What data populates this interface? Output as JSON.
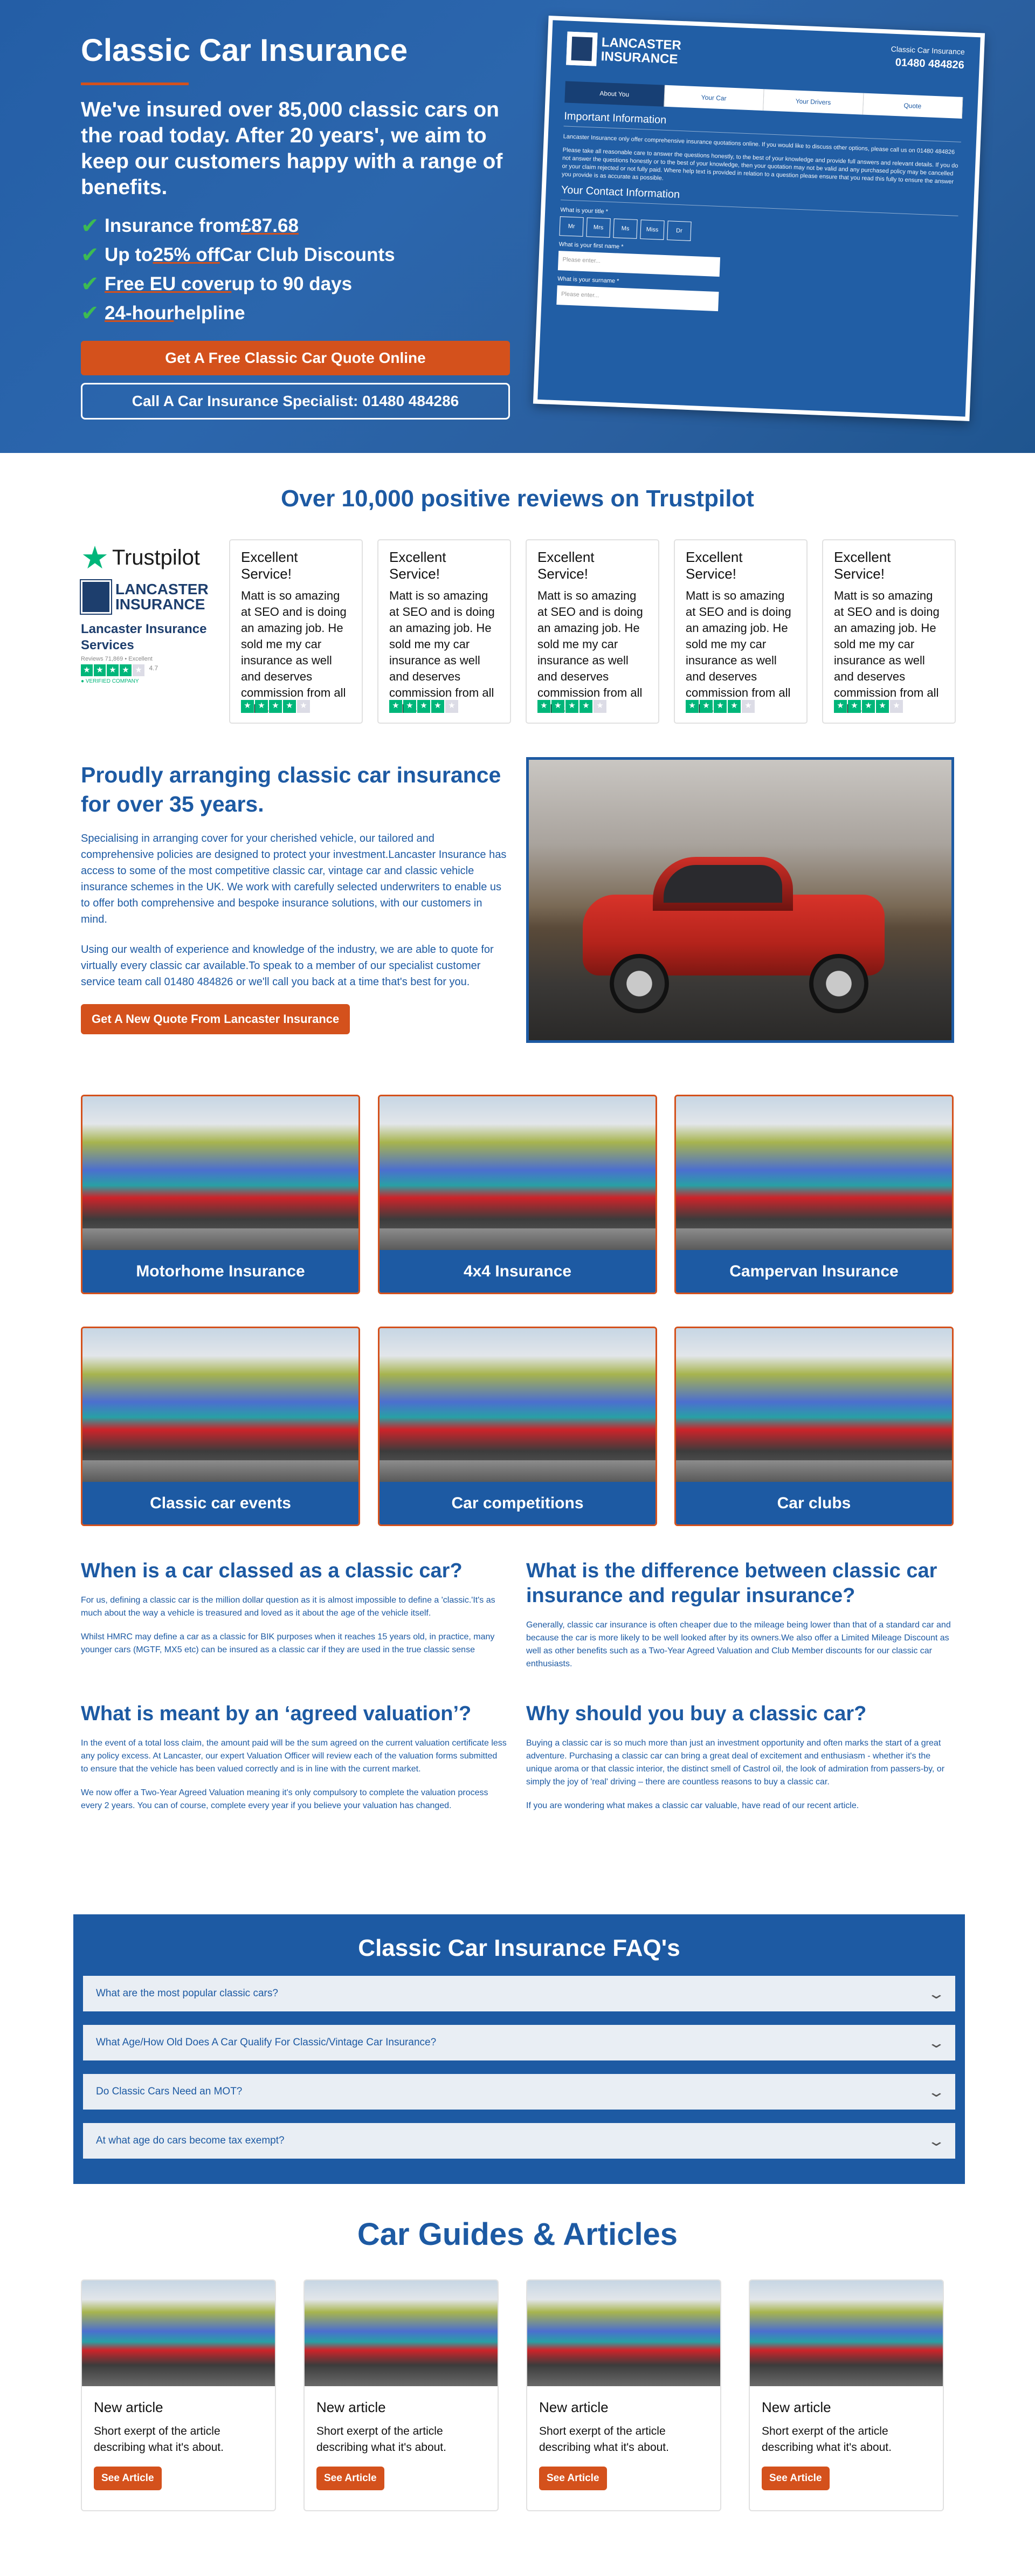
{
  "hero": {
    "title": "Classic Car Insurance",
    "intro": "We've insured over 85,000 classic cars on the road today. After 20 years', we aim to keep our customers happy with a range of benefits.",
    "benefits": [
      {
        "pre": "Insurance from ",
        "highlight": "£87.68",
        "post": ""
      },
      {
        "pre": "Up to ",
        "highlight": "25% off",
        "post": " Car Club Discounts"
      },
      {
        "pre": "",
        "highlight": "Free EU cover",
        "post": " up to 90 days"
      },
      {
        "pre": "",
        "highlight": "24-hour",
        "post": " helpline"
      }
    ],
    "cta_quote": "Get A Free Classic Car Quote Online",
    "cta_call": "Call A Car Insurance Specialist: 01480 484286"
  },
  "form": {
    "logo_line1": "LANCASTER",
    "logo_line2": "INSURANCE",
    "contact_label": "Classic Car Insurance",
    "phone": "01480 484826",
    "steps": [
      "About You",
      "Your Car",
      "Your Drivers",
      "Quote"
    ],
    "important_title": "Important Information",
    "important_text1": "Lancaster Insurance only offer comprehensive insurance quotations online. If you would like to discuss other options, please call us on 01480 484826",
    "important_text2": "Please take all reasonable care to answer the questions honestly, to the best of your knowledge and provide full answers and relevant details. If you do not answer the questions honestly or to the best of your knowledge, then your quotation may not be valid and any purchased policy may be cancelled or your claim rejected or not fully paid. Where help text is provided in relation to a question please ensure that you read this fully to ensure the answer you provide is as accurate as possible.",
    "contact_title": "Your Contact Information",
    "title_label": "What is your title *",
    "title_options": [
      "Mr",
      "Mrs",
      "Ms",
      "Miss",
      "Dr"
    ],
    "first_label": "What is your first name *",
    "first_placeholder": "Please enter...",
    "surname_label": "What is your surname *",
    "surname_placeholder": "Please enter..."
  },
  "reviews": {
    "title": "Over 10,000 positive reviews on Trustpilot",
    "trustpilot": "Trustpilot",
    "logo_line1": "LANCASTER",
    "logo_line2": "INSURANCE",
    "company": "Lancaster Insurance Services",
    "sub": "Reviews 71,869 • Excellent",
    "score": "4.7",
    "verified": "● VERIFIED COMPANY",
    "items": [
      {
        "title": "Excellent Service!",
        "text": "Matt is so amazing at SEO and is doing an amazing job. He sold me my car insurance as well and deserves commission from all sales",
        "rating": 4
      },
      {
        "title": "Excellent Service!",
        "text": "Matt is so amazing at SEO and is doing an amazing job. He sold me my car insurance as well and deserves commission from all sales",
        "rating": 4
      },
      {
        "title": "Excellent Service!",
        "text": "Matt is so amazing at SEO and is doing an amazing job. He sold me my car insurance as well and deserves commission from all sales",
        "rating": 4
      },
      {
        "title": "Excellent Service!",
        "text": "Matt is so amazing at SEO and is doing an amazing job. He sold me my car insurance as well and deserves commission from all sales",
        "rating": 4
      },
      {
        "title": "Excellent Service!",
        "text": "Matt is so amazing at SEO and is doing an amazing job. He sold me my car insurance as well and deserves commission from all sales",
        "rating": 4
      }
    ]
  },
  "about": {
    "title": "Proudly arranging classic car insurance for over 35 years.",
    "p1": "Specialising in arranging cover for your cherished vehicle, our tailored and comprehensive policies are designed to protect your investment.Lancaster Insurance has access to some of the most competitive classic car, vintage car and classic vehicle insurance schemes in the UK. We work with carefully selected underwriters to enable us to offer both comprehensive and bespoke insurance solutions, with our customers in mind.",
    "p2": "Using our wealth of experience and knowledge of the industry, we are able to quote for virtually every classic car available.To speak to a member of our specialist customer service team call 01480 484826 or we'll call you back at a time that's best for you.",
    "cta": "Get A New Quote From Lancaster Insurance"
  },
  "tiles": [
    "Motorhome Insurance",
    "4x4 Insurance",
    "Campervan Insurance",
    "Classic car events",
    "Car competitions",
    "Car clubs"
  ],
  "info": {
    "q1": {
      "title": "When is a car classed as a classic car?",
      "p1": "For us, defining a classic car is the million dollar question as it is almost impossible to define a 'classic.'It's as much about the way a vehicle is treasured and loved as it about the age of the vehicle itself.",
      "p2": "Whilst HMRC may define a car as a classic for BIK purposes when it reaches 15 years old, in practice, many younger cars (MGTF, MX5 etc) can be insured as a classic car if they are used in the true classic sense"
    },
    "q2": {
      "title": "What is the difference between classic car insurance and regular insurance?",
      "p1": "Generally, classic car insurance is often cheaper due to the mileage being lower than that of a standard car and because the car is more likely to be well looked after by its owners.We also offer a Limited Mileage Discount as well as other benefits such as a Two-Year Agreed Valuation and Club Member discounts for our classic car enthusiasts."
    },
    "q3": {
      "title": "What is meant by an ‘agreed valuation’?",
      "p1": "In the event of a total loss claim, the amount paid will be the sum agreed on the current valuation certificate less any policy excess. At Lancaster, our expert Valuation Officer will review each of the valuation forms submitted to ensure that the vehicle has been valued correctly and is in line with the current market.",
      "p2": "We now offer a Two-Year Agreed Valuation meaning it's only compulsory to complete the valuation process every 2 years. You can of course, complete every year if you believe your valuation has changed."
    },
    "q4": {
      "title": "Why should you buy a classic car?",
      "p1": "Buying a classic car is so much more than just an investment opportunity and often marks the start of a great adventure. Purchasing a classic car can bring a great deal of excitement and enthusiasm - whether it's the unique aroma or that classic interior, the distinct smell of Castrol oil, the look of admiration from passers-by, or simply the joy of 'real' driving – there are countless reasons to buy a classic car.",
      "p2": "If you are wondering what makes a classic car valuable, have read of our recent article."
    }
  },
  "faq": {
    "title": "Classic Car Insurance FAQ's",
    "items": [
      "What are the most popular classic cars?",
      "What Age/How Old Does A Car Qualify For Classic/Vintage Car Insurance?",
      "Do Classic Cars Need an MOT?",
      "At what age do cars become tax exempt?"
    ]
  },
  "articles": {
    "title": "Car Guides & Articles",
    "items": [
      {
        "title": "New article",
        "text": "Short exerpt of the article describing what it's about.",
        "button": "See Article"
      },
      {
        "title": "New article",
        "text": "Short exerpt of the article describing what it's about.",
        "button": "See Article"
      },
      {
        "title": "New article",
        "text": "Short exerpt of the article describing what it's about.",
        "button": "See Article"
      },
      {
        "title": "New article",
        "text": "Short exerpt of the article describing what it's about.",
        "button": "See Article"
      }
    ]
  },
  "colors": {
    "brand_blue": "#1d5aa3",
    "accent_orange": "#d4511c",
    "trustpilot_green": "#00b67a"
  }
}
